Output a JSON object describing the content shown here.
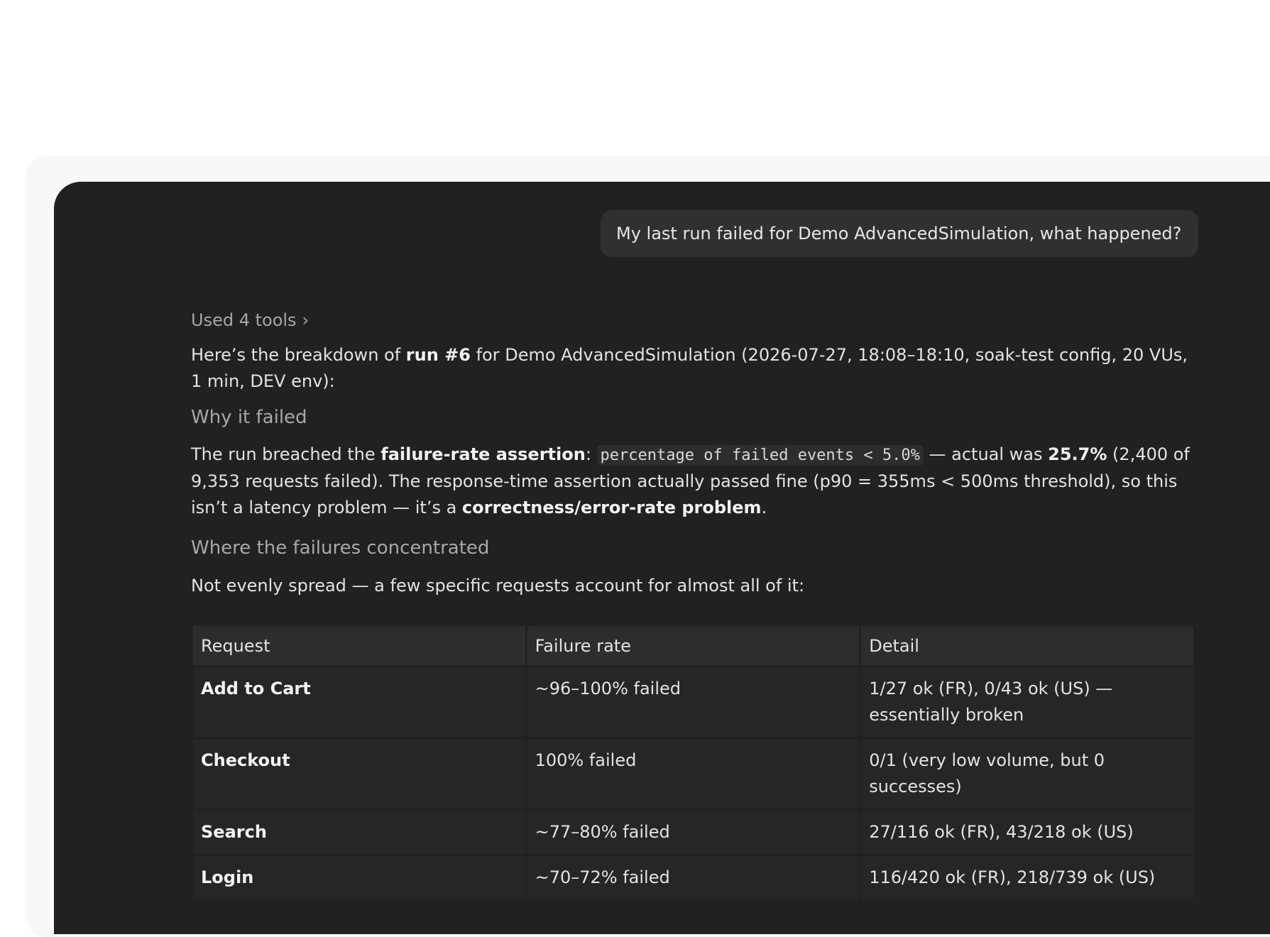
{
  "user_message": "My last run failed for Demo AdvancedSimulation, what happened?",
  "assistant": {
    "tools_label": "Used 4 tools",
    "intro": {
      "before": "Here’s the breakdown of ",
      "bold": "run #6",
      "after": " for Demo AdvancedSimulation (2026-07-27, 18:08–18:10, soak-test config, 20 VUs, 1 min, DEV env):"
    },
    "heading_why": "Why it failed",
    "why": {
      "t1": "The run breached the ",
      "b1": "failure-rate assertion",
      "t2": ": ",
      "code": "percentage of failed events < 5.0%",
      "t3": " — actual was ",
      "b2": "25.7%",
      "t4": " (2,400 of 9,353 requests failed). The response-time assertion actually passed fine (p90 = 355ms < 500ms threshold), so this isn’t a latency problem — it’s a ",
      "b3": "correctness/error-rate problem",
      "t5": "."
    },
    "heading_where": "Where the failures concentrated",
    "where_text": "Not evenly spread — a few specific requests account for almost all of it:",
    "table": {
      "headers": [
        "Request",
        "Failure rate",
        "Detail"
      ],
      "rows": [
        [
          "Add to Cart",
          "~96–100% failed",
          "1/27 ok (FR), 0/43 ok (US) — essentially broken"
        ],
        [
          "Checkout",
          "100% failed",
          "0/1 (very low volume, but 0 successes)"
        ],
        [
          "Search",
          "~77–80% failed",
          "27/116 ok (FR), 43/218 ok (US)"
        ],
        [
          "Login",
          "~70–72% failed",
          "116/420 ok (FR), 218/739 ok (US)"
        ]
      ]
    }
  }
}
